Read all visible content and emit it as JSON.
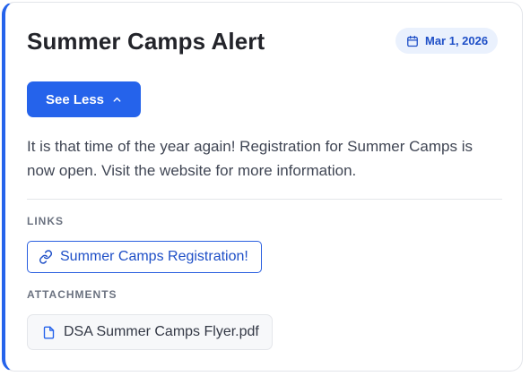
{
  "announcement": {
    "title": "Summer Camps Alert",
    "date": "Mar 1, 2026",
    "toggle_label": "See Less",
    "body": "It is that time of the year again! Registration for Summer Camps is now open. Visit the website for more information.",
    "links_heading": "LINKS",
    "links": [
      {
        "label": "Summer Camps Registration!",
        "icon": "link-icon"
      }
    ],
    "attachments_heading": "ATTACHMENTS",
    "attachments": [
      {
        "label": "DSA Summer Camps Flyer.pdf",
        "icon": "file-icon"
      }
    ]
  },
  "colors": {
    "accent": "#2563eb",
    "badge_bg": "#eaf1fd",
    "badge_text": "#1e4fc7",
    "text": "#404654"
  }
}
